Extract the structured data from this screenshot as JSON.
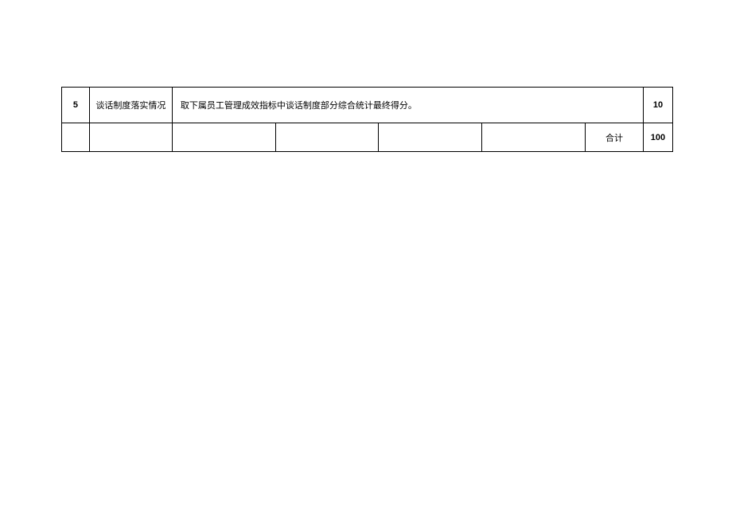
{
  "rows": [
    {
      "num": "5",
      "title": "谈话制度落实情况",
      "desc": "取下属员工管理成效指标中谈话制度部分综合统计最终得分。",
      "score": "10"
    }
  ],
  "total": {
    "label": "合计",
    "value": "100"
  }
}
